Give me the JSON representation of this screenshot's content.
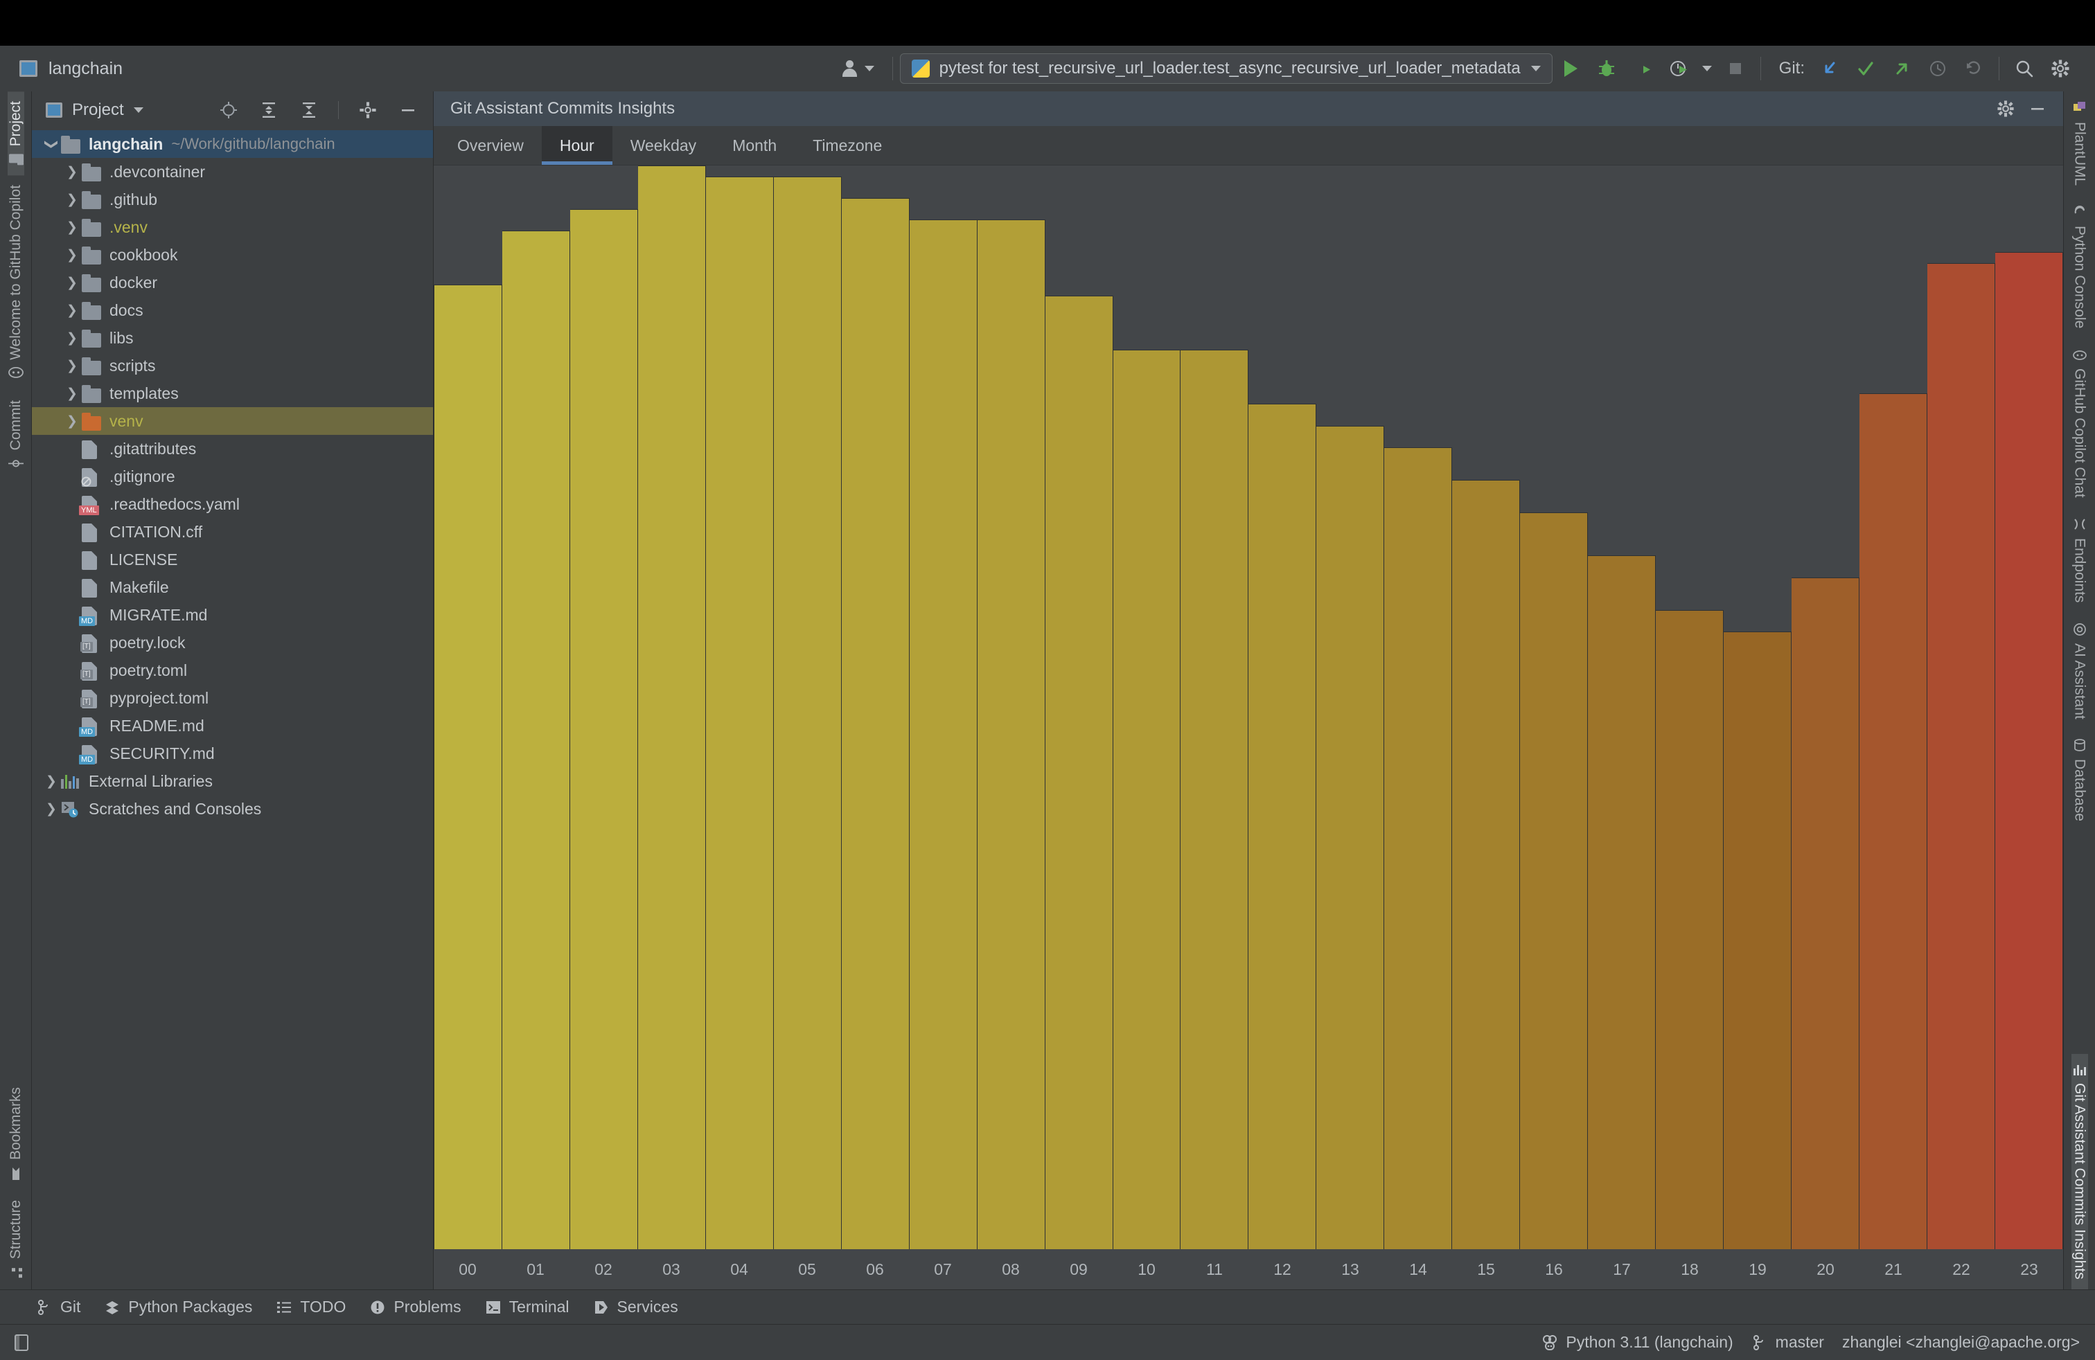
{
  "window": {
    "project_name": "langchain"
  },
  "toolbar": {
    "run_config": {
      "label": "pytest for test_recursive_url_loader.test_async_recursive_url_loader_metadata",
      "icon": "python-icon"
    },
    "git_label": "Git:",
    "actions": [
      "run-button",
      "debug-button",
      "run-coverage-button",
      "profile-button",
      "stop-button"
    ],
    "git_actions": [
      "update-project-button",
      "commit-button",
      "push-button",
      "history-button",
      "rollback-button"
    ],
    "right_actions": [
      "search-everywhere-button",
      "settings-button"
    ]
  },
  "left_toolbar": {
    "top": [
      {
        "label": "Project",
        "icon": "project-icon",
        "selected": true
      },
      {
        "label": "Welcome to GitHub Copilot",
        "icon": "copilot-icon",
        "selected": false
      },
      {
        "label": "Commit",
        "icon": "commit-icon",
        "selected": false
      }
    ],
    "bottom": [
      {
        "label": "Bookmarks",
        "icon": "bookmark-icon",
        "selected": false
      },
      {
        "label": "Structure",
        "icon": "structure-icon",
        "selected": false
      }
    ]
  },
  "right_toolbar": {
    "items": [
      {
        "label": "PlantUML",
        "icon": "plantuml-icon",
        "selected": false
      },
      {
        "label": "Python Console",
        "icon": "python-console-icon",
        "selected": false
      },
      {
        "label": "GitHub Copilot Chat",
        "icon": "copilot-chat-icon",
        "selected": false
      },
      {
        "label": "Endpoints",
        "icon": "endpoints-icon",
        "selected": false
      },
      {
        "label": "AI Assistant",
        "icon": "ai-assistant-icon",
        "selected": false
      },
      {
        "label": "Database",
        "icon": "database-icon",
        "selected": false
      },
      {
        "label": "Git Assistant Commits Insights",
        "icon": "chart-icon",
        "selected": true
      }
    ]
  },
  "project_panel": {
    "title": "Project",
    "actions": [
      "locate-icon",
      "expand-all-icon",
      "collapse-all-icon",
      "gear-icon",
      "minimize-icon"
    ],
    "tree": [
      {
        "name": "langchain",
        "path": "~/Work/github/langchain",
        "type": "root",
        "expanded": true,
        "selected": "blue",
        "indent": 0
      },
      {
        "name": ".devcontainer",
        "type": "folder",
        "indent": 1
      },
      {
        "name": ".github",
        "type": "folder",
        "indent": 1
      },
      {
        "name": ".venv",
        "type": "folder",
        "color": "olive",
        "indent": 1
      },
      {
        "name": "cookbook",
        "type": "folder",
        "indent": 1
      },
      {
        "name": "docker",
        "type": "folder",
        "indent": 1
      },
      {
        "name": "docs",
        "type": "folder",
        "indent": 1
      },
      {
        "name": "libs",
        "type": "folder",
        "indent": 1
      },
      {
        "name": "scripts",
        "type": "folder",
        "indent": 1
      },
      {
        "name": "templates",
        "type": "folder",
        "indent": 1
      },
      {
        "name": "venv",
        "type": "folder",
        "color": "olive",
        "folder_color": "orange",
        "selected": "olive",
        "indent": 1
      },
      {
        "name": ".gitattributes",
        "type": "file",
        "indent": 1
      },
      {
        "name": ".gitignore",
        "type": "file",
        "badge": "ignore",
        "indent": 1
      },
      {
        "name": ".readthedocs.yaml",
        "type": "file",
        "badge": "YML",
        "indent": 1
      },
      {
        "name": "CITATION.cff",
        "type": "file",
        "indent": 1
      },
      {
        "name": "LICENSE",
        "type": "file",
        "indent": 1
      },
      {
        "name": "Makefile",
        "type": "file",
        "indent": 1
      },
      {
        "name": "MIGRATE.md",
        "type": "file",
        "badge": "MD",
        "indent": 1
      },
      {
        "name": "poetry.lock",
        "type": "file",
        "badge": "TOML",
        "indent": 1
      },
      {
        "name": "poetry.toml",
        "type": "file",
        "badge": "TOML",
        "indent": 1
      },
      {
        "name": "pyproject.toml",
        "type": "file",
        "badge": "TOML",
        "indent": 1
      },
      {
        "name": "README.md",
        "type": "file",
        "badge": "MD",
        "indent": 1
      },
      {
        "name": "SECURITY.md",
        "type": "file",
        "badge": "MD",
        "indent": 1
      },
      {
        "name": "External Libraries",
        "type": "libs",
        "indent": 0
      },
      {
        "name": "Scratches and Consoles",
        "type": "scratches",
        "indent": 0
      }
    ]
  },
  "git_assistant": {
    "header_title": "Git Assistant Commits Insights",
    "header_actions": [
      "gear-icon",
      "minimize-icon"
    ],
    "tabs": [
      {
        "label": "Overview",
        "active": false
      },
      {
        "label": "Hour",
        "active": true
      },
      {
        "label": "Weekday",
        "active": false
      },
      {
        "label": "Month",
        "active": false
      },
      {
        "label": "Timezone",
        "active": false
      }
    ]
  },
  "chart_data": {
    "type": "bar",
    "title": "Git Assistant Commits Insights — Hour",
    "xlabel": "",
    "ylabel": "",
    "grid": false,
    "legend": null,
    "ylim": [
      0,
      100
    ],
    "categories": [
      "00",
      "01",
      "02",
      "03",
      "04",
      "05",
      "06",
      "07",
      "08",
      "09",
      "10",
      "11",
      "12",
      "13",
      "14",
      "15",
      "16",
      "17",
      "18",
      "19",
      "20",
      "21",
      "22",
      "23"
    ],
    "values": [
      89,
      94,
      96,
      100,
      99,
      99,
      97,
      95,
      95,
      88,
      83,
      83,
      78,
      76,
      74,
      71,
      68,
      64,
      59,
      57,
      62,
      79,
      91,
      92
    ],
    "bar_colors": [
      "#bdb23f",
      "#bcb03e",
      "#bbae3d",
      "#b9ab3c",
      "#b8a93b",
      "#b6a63a",
      "#b5a439",
      "#b3a138",
      "#b29f37",
      "#b09c36",
      "#af9a35",
      "#ad9734",
      "#ac9533",
      "#a99031",
      "#a6892f",
      "#a3822d",
      "#a07b2b",
      "#9d7429",
      "#9a6d27",
      "#976625",
      "#9e5f2a",
      "#a5562d",
      "#ab4d30",
      "#b04433"
    ],
    "gradient_start": "#c3ba45",
    "gradient_end": "#b5352c"
  },
  "tool_window_bar": {
    "items": [
      {
        "label": "Git",
        "icon": "git-branch-icon"
      },
      {
        "label": "Python Packages",
        "icon": "packages-icon"
      },
      {
        "label": "TODO",
        "icon": "todo-list-icon"
      },
      {
        "label": "Problems",
        "icon": "problems-icon"
      },
      {
        "label": "Terminal",
        "icon": "terminal-icon"
      },
      {
        "label": "Services",
        "icon": "services-icon"
      }
    ]
  },
  "status_bar": {
    "left_icon": "layout-icon",
    "right": [
      {
        "label": "Python 3.11 (langchain)",
        "icon": "python-interpreter-icon"
      },
      {
        "label": "master",
        "icon": "git-branch-icon"
      },
      {
        "label": "zhanglei <zhanglei@apache.org>",
        "icon": ""
      }
    ]
  }
}
